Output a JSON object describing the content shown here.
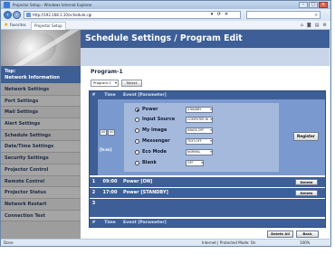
{
  "browser": {
    "title": "Projector Setup - Windows Internet Explorer",
    "url": "http://192.168.1.10/schedule.cgi",
    "favorites_label": "Favorites",
    "tab_label": "Projector Setup",
    "status_left": "Done",
    "status_zone": "Internet | Protected Mode: On",
    "status_zoom": "100%"
  },
  "sidebar": {
    "heading_line1": "Top:",
    "heading_line2": "Network Information",
    "items": [
      "Network Settings",
      "Port Settings",
      "Mail Settings",
      "Alert Settings",
      "Schedule Settings",
      "Date/Time Settings",
      "Security Settings",
      "Projector Control",
      "Remote Control",
      "Projector Status",
      "Network Restart",
      "Connection Test"
    ]
  },
  "header": {
    "title": "Schedule Settings / Program Edit"
  },
  "program": {
    "title": "Program-1",
    "select_value": "Program-1",
    "select_button": "Select"
  },
  "table": {
    "col_number": "#",
    "col_time": "Time",
    "col_event": "Event [Parameter]"
  },
  "edit": {
    "time_hour": "00",
    "time_minute": "00",
    "time_hint": "[h:m]",
    "params": [
      {
        "label": "Power",
        "value": "STANDBY"
      },
      {
        "label": "Input Source",
        "value": "COMPUTER IN"
      },
      {
        "label": "My Image",
        "value": "IMAGE-OFF"
      },
      {
        "label": "Messenger",
        "value": "TEXT-OFF"
      },
      {
        "label": "Eco Mode",
        "value": "NORMAL"
      },
      {
        "label": "Blank",
        "value": "OFF"
      }
    ],
    "register_label": "Register"
  },
  "rows": [
    {
      "number": "1",
      "time": "09:00",
      "event": "Power [ON]",
      "delete_label": "Delete"
    },
    {
      "number": "2",
      "time": "17:00",
      "event": "Power [STANDBY]",
      "delete_label": "Delete"
    },
    {
      "number": "3",
      "time": "",
      "event": ""
    }
  ],
  "footer_buttons": {
    "delete_all": "Delete All",
    "back": "Back"
  }
}
